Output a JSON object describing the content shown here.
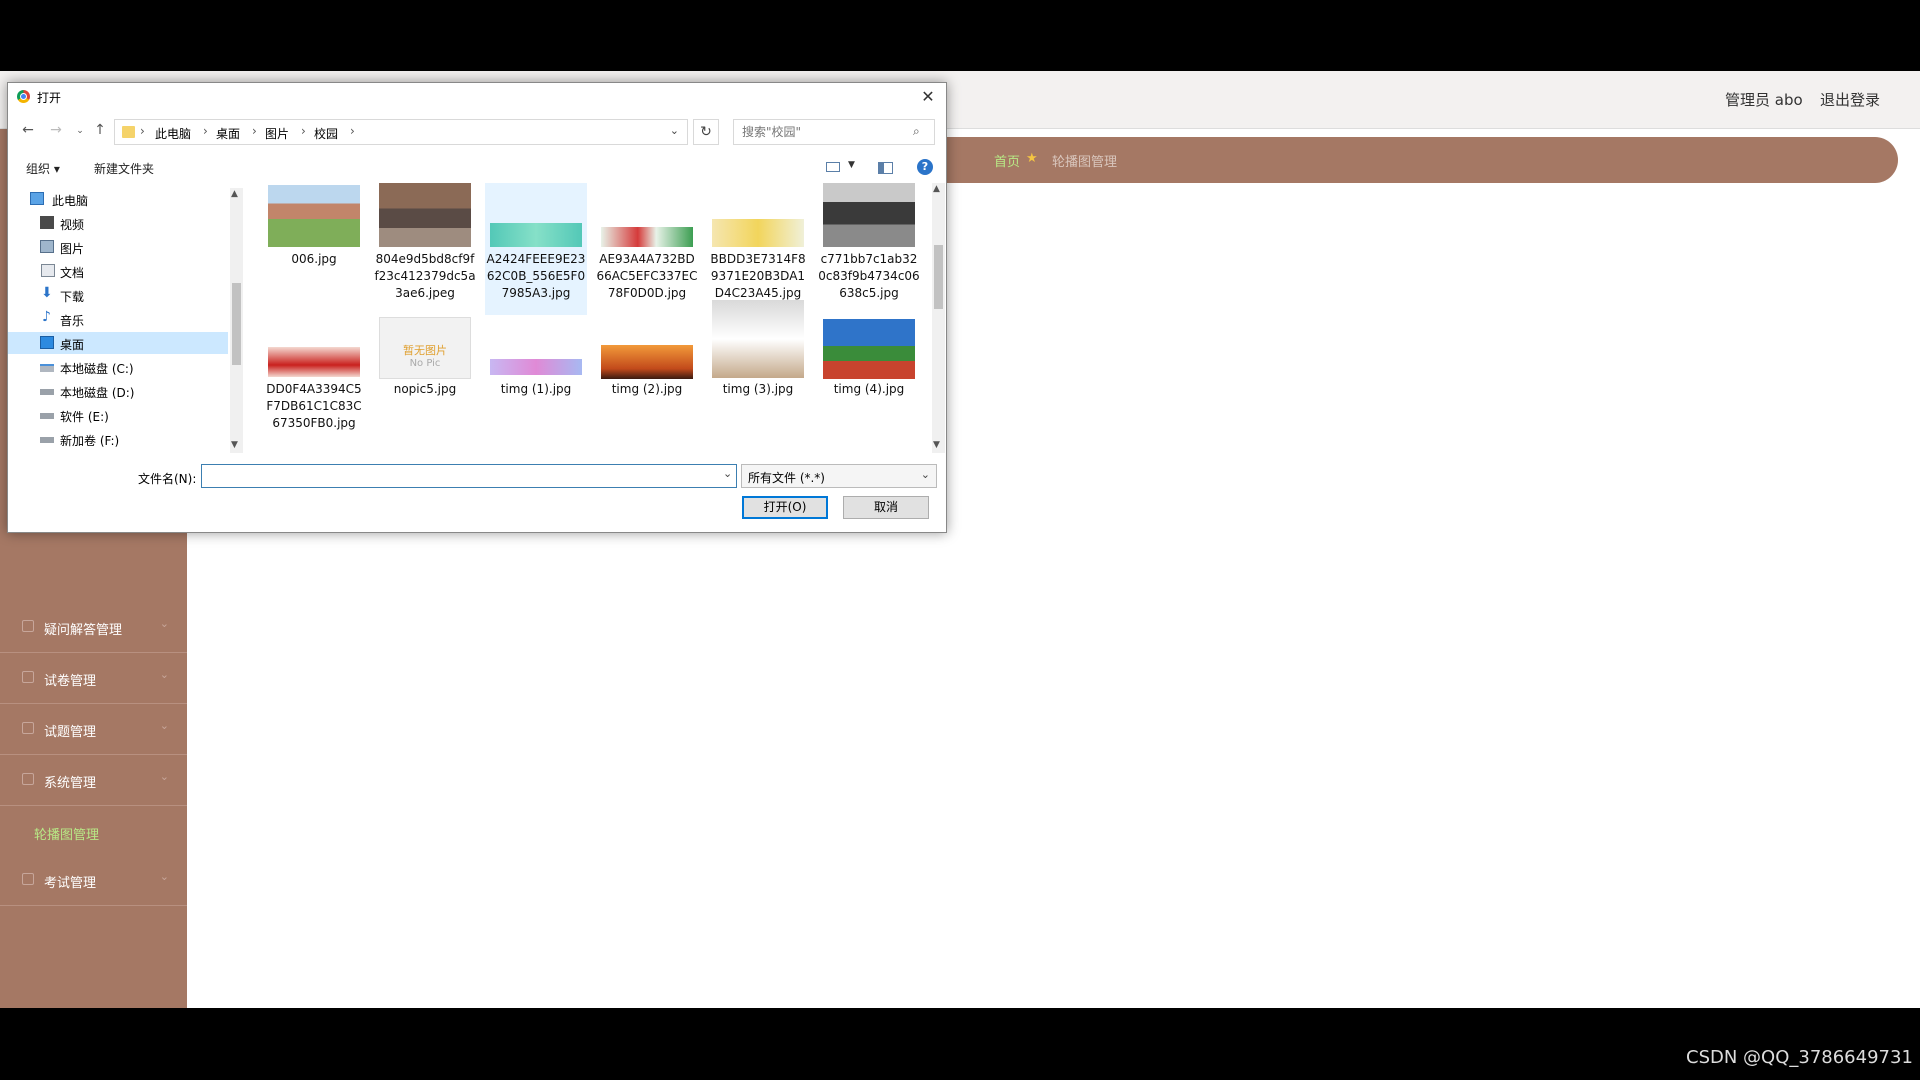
{
  "app": {
    "header": {
      "user": "管理员 abo",
      "logout": "退出登录"
    },
    "breadcrumb": {
      "home": "首页",
      "current": "轮播图管理"
    },
    "sidebar": {
      "items": [
        {
          "label": "疑问解答管理"
        },
        {
          "label": "试卷管理"
        },
        {
          "label": "试题管理"
        },
        {
          "label": "系统管理"
        },
        {
          "label": "考试管理"
        }
      ],
      "sub_active": "轮播图管理"
    }
  },
  "dialog": {
    "title": "打开",
    "path": [
      "此电脑",
      "桌面",
      "图片",
      "校园"
    ],
    "search_placeholder": "搜索\"校园\"",
    "toolbar": {
      "organize": "组织 ▾",
      "new_folder": "新建文件夹"
    },
    "tree": [
      {
        "label": "此电脑",
        "icon": "computer-icon"
      },
      {
        "label": "视频",
        "icon": "video-folder-icon"
      },
      {
        "label": "图片",
        "icon": "pictures-folder-icon"
      },
      {
        "label": "文档",
        "icon": "documents-folder-icon"
      },
      {
        "label": "下载",
        "icon": "download-icon"
      },
      {
        "label": "音乐",
        "icon": "music-icon"
      },
      {
        "label": "桌面",
        "icon": "desktop-icon",
        "selected": true
      },
      {
        "label": "本地磁盘 (C:)",
        "icon": "drive-icon"
      },
      {
        "label": "本地磁盘 (D:)",
        "icon": "drive-icon"
      },
      {
        "label": "软件 (E:)",
        "icon": "drive-icon"
      },
      {
        "label": "新加卷 (F:)",
        "icon": "drive-icon"
      }
    ],
    "files": [
      {
        "name": "006.jpg"
      },
      {
        "name": "804e9d5bd8cf9ff23c412379dc5a3ae6.jpeg"
      },
      {
        "name": "A2424FEEE9E2362C0B_556E5F07985A3.jpg",
        "hover": true
      },
      {
        "name": "AE93A4A732BD66AC5EFC337EC78F0D0D.jpg"
      },
      {
        "name": "BBDD3E7314F89371E20B3DA1D4C23A45.jpg"
      },
      {
        "name": "c771bb7c1ab320c83f9b4734c06638c5.jpg"
      },
      {
        "name": "DD0F4A3394C5F7DB61C1C83C67350FB0.jpg"
      },
      {
        "name": "nopic5.jpg",
        "thumb_text": "暂无图片",
        "thumb_subtext": "No Pic"
      },
      {
        "name": "timg (1).jpg"
      },
      {
        "name": "timg (2).jpg"
      },
      {
        "name": "timg (3).jpg"
      },
      {
        "name": "timg (4).jpg"
      }
    ],
    "filename_label": "文件名(N):",
    "filename_value": "",
    "filetype": "所有文件 (*.*)",
    "open_button": "打开(O)",
    "cancel_button": "取消"
  },
  "watermark": "CSDN @QQ_3786649731"
}
